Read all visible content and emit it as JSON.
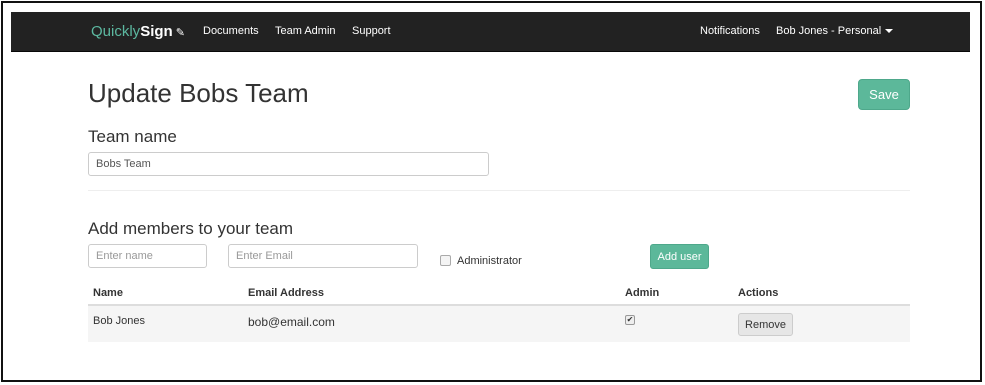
{
  "nav": {
    "brand_part1": "Quickly",
    "brand_part2": "Sign",
    "links": [
      "Documents",
      "Team Admin",
      "Support"
    ],
    "notifications": "Notifications",
    "user_menu": "Bob Jones - Personal"
  },
  "page": {
    "title": "Update Bobs Team",
    "save_label": "Save"
  },
  "team_name": {
    "heading": "Team name",
    "value": "Bobs Team"
  },
  "add_members": {
    "heading": "Add members to your team",
    "name_placeholder": "Enter name",
    "email_placeholder": "Enter Email",
    "administrator_label": "Administrator",
    "administrator_checked": false,
    "add_label": "Add user"
  },
  "table": {
    "headers": [
      "Name",
      "Email Address",
      "Admin",
      "Actions"
    ],
    "rows": [
      {
        "name": "Bob Jones",
        "email": "bob@email.com",
        "admin": true,
        "action_label": "Remove"
      }
    ]
  },
  "colors": {
    "navbar": "#222222",
    "brand_accent": "#5cb8a0",
    "primary_button": "#5cb89a"
  }
}
